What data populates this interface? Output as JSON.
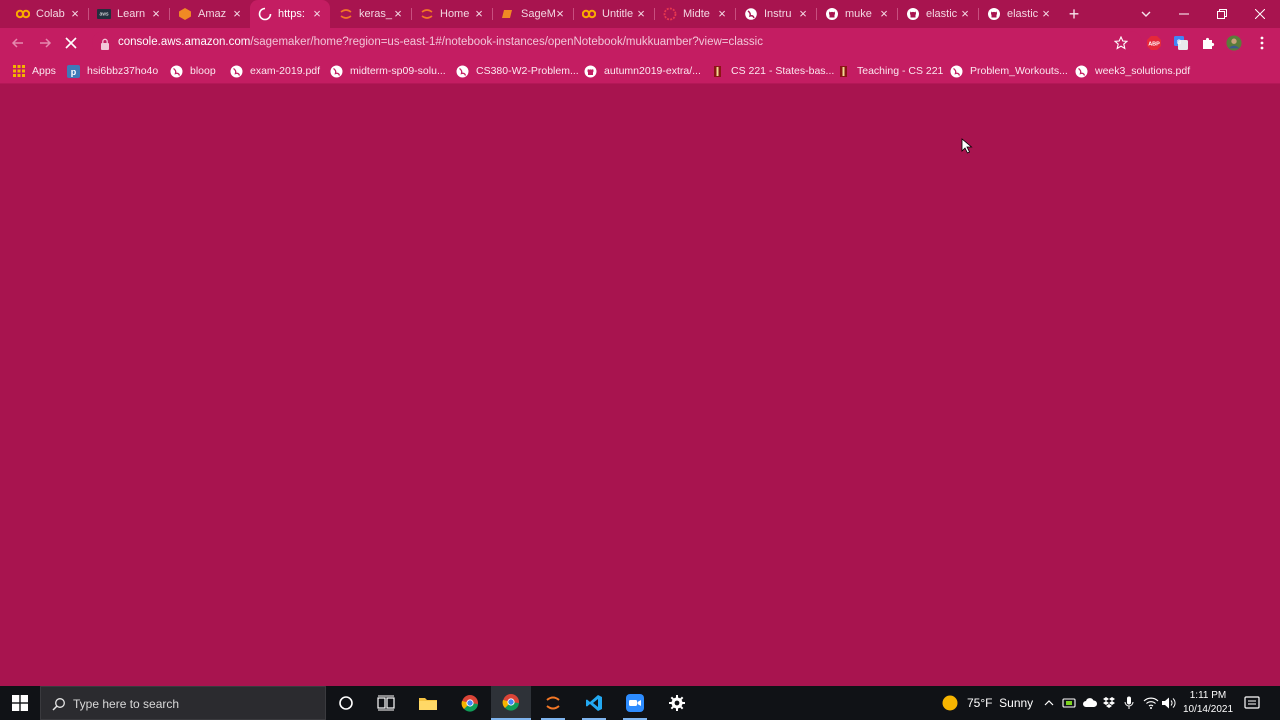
{
  "tabs": [
    {
      "title": "Colab",
      "icon": "colab-icon"
    },
    {
      "title": "Learn",
      "icon": "aws-icon"
    },
    {
      "title": "Amaz",
      "icon": "sagemaker-icon"
    },
    {
      "title": "https:",
      "icon": "loading-spinner-icon",
      "active": true
    },
    {
      "title": "keras_",
      "icon": "jupyter-icon"
    },
    {
      "title": "Home",
      "icon": "jupyter-icon"
    },
    {
      "title": "SageM",
      "icon": "sagemaker-icon"
    },
    {
      "title": "Untitle",
      "icon": "colab-icon"
    },
    {
      "title": "Midte",
      "icon": "gradescope-icon"
    },
    {
      "title": "Instru",
      "icon": "globe-icon"
    },
    {
      "title": "muke",
      "icon": "github-icon"
    },
    {
      "title": "elastic",
      "icon": "github-icon"
    },
    {
      "title": "elastic",
      "icon": "github-icon"
    }
  ],
  "address_bar": {
    "host": "console.aws.amazon.com",
    "path": "/sagemaker/home?region=us-east-1#/notebook-instances/openNotebook/mukkuamber?view=classic"
  },
  "bookmarks": [
    {
      "label": "Apps",
      "icon": "apps-grid-icon"
    },
    {
      "label": "hsi6bbz37ho4o",
      "icon": "piazza-icon"
    },
    {
      "label": "bloop",
      "icon": "globe-icon"
    },
    {
      "label": "exam-2019.pdf",
      "icon": "globe-icon"
    },
    {
      "label": "midterm-sp09-solu...",
      "icon": "globe-icon"
    },
    {
      "label": "CS380-W2-Problem...",
      "icon": "globe-icon"
    },
    {
      "label": "autumn2019-extra/...",
      "icon": "github-icon"
    },
    {
      "label": "CS 221 - States-bas...",
      "icon": "stanford-icon"
    },
    {
      "label": "Teaching - CS 221",
      "icon": "stanford-icon"
    },
    {
      "label": "Problem_Workouts...",
      "icon": "globe-icon"
    },
    {
      "label": "week3_solutions.pdf",
      "icon": "globe-icon"
    }
  ],
  "taskbar": {
    "search_placeholder": "Type here to search",
    "weather": "75°F  Sunny",
    "time": "1:11 PM",
    "date": "10/14/2021"
  },
  "colors": {
    "page_background": "#a8144f",
    "chrome_toolbar": "#c41d62",
    "taskbar": "#101216"
  }
}
